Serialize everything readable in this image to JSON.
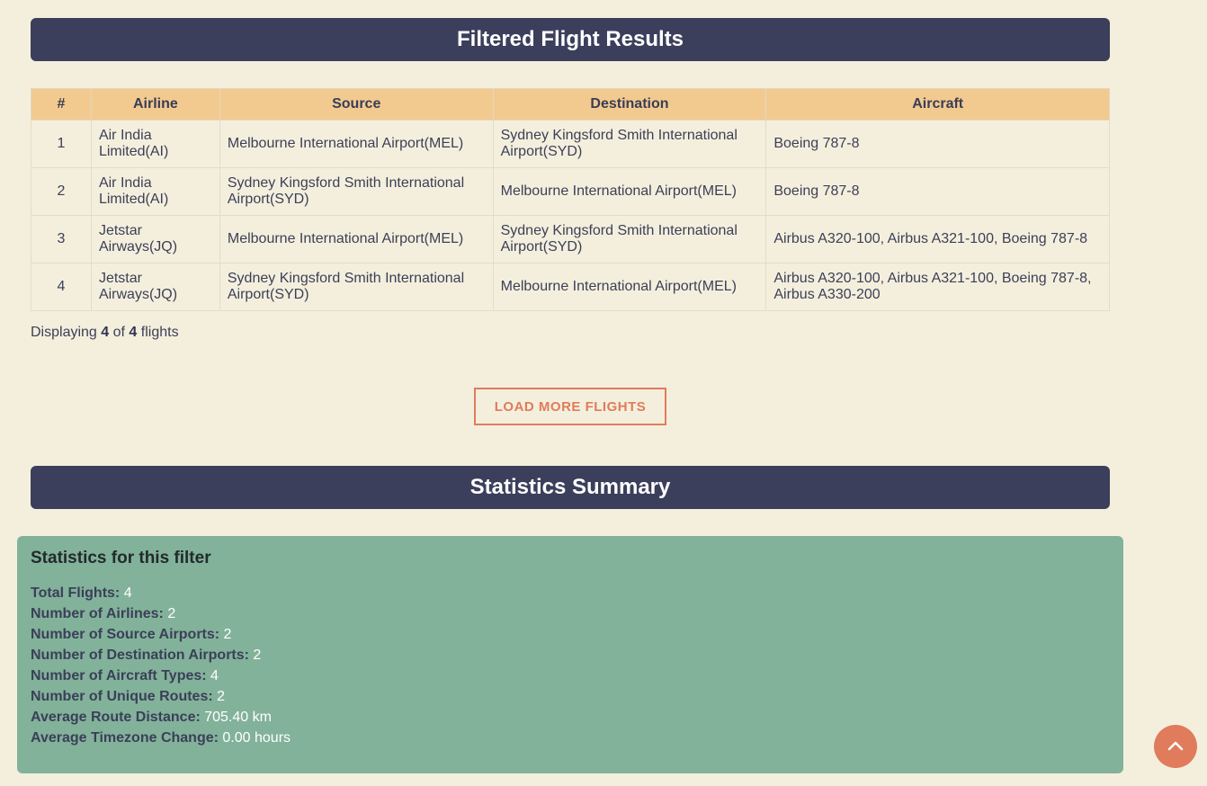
{
  "results": {
    "heading": "Filtered Flight Results",
    "columns": [
      "#",
      "Airline",
      "Source",
      "Destination",
      "Aircraft"
    ],
    "rows": [
      {
        "num": "1",
        "airline": "Air India Limited(AI)",
        "source": "Melbourne International Airport(MEL)",
        "destination": "Sydney Kingsford Smith International Airport(SYD)",
        "aircraft": "Boeing 787-8"
      },
      {
        "num": "2",
        "airline": "Air India Limited(AI)",
        "source": "Sydney Kingsford Smith International Airport(SYD)",
        "destination": "Melbourne International Airport(MEL)",
        "aircraft": "Boeing 787-8"
      },
      {
        "num": "3",
        "airline": "Jetstar Airways(JQ)",
        "source": "Melbourne International Airport(MEL)",
        "destination": "Sydney Kingsford Smith International Airport(SYD)",
        "aircraft": "Airbus A320-100, Airbus A321-100, Boeing 787-8"
      },
      {
        "num": "4",
        "airline": "Jetstar Airways(JQ)",
        "source": "Sydney Kingsford Smith International Airport(SYD)",
        "destination": "Melbourne International Airport(MEL)",
        "aircraft": "Airbus A320-100, Airbus A321-100, Boeing 787-8, Airbus A330-200"
      }
    ],
    "count": {
      "prefix": "Displaying",
      "shown": "4",
      "of": "of",
      "total": "4",
      "suffix": "flights"
    },
    "load_more_label": "LOAD MORE FLIGHTS"
  },
  "stats": {
    "heading": "Statistics Summary",
    "box_title": "Statistics for this filter",
    "items": [
      {
        "label": "Total Flights:",
        "value": "4"
      },
      {
        "label": "Number of Airlines:",
        "value": "2"
      },
      {
        "label": "Number of Source Airports:",
        "value": "2"
      },
      {
        "label": "Number of Destination Airports:",
        "value": "2"
      },
      {
        "label": "Number of Aircraft Types:",
        "value": "4"
      },
      {
        "label": "Number of Unique Routes:",
        "value": "2"
      },
      {
        "label": "Average Route Distance:",
        "value": "705.40 km"
      },
      {
        "label": "Average Timezone Change:",
        "value": "0.00 hours"
      }
    ]
  },
  "scroll_top": {
    "icon": "chevron-up-icon"
  },
  "colors": {
    "background": "#f4efdd",
    "header_bar": "#3c3f5b",
    "table_header": "#f2ca90",
    "accent": "#e07b5c",
    "stats_box": "#82b29a"
  }
}
